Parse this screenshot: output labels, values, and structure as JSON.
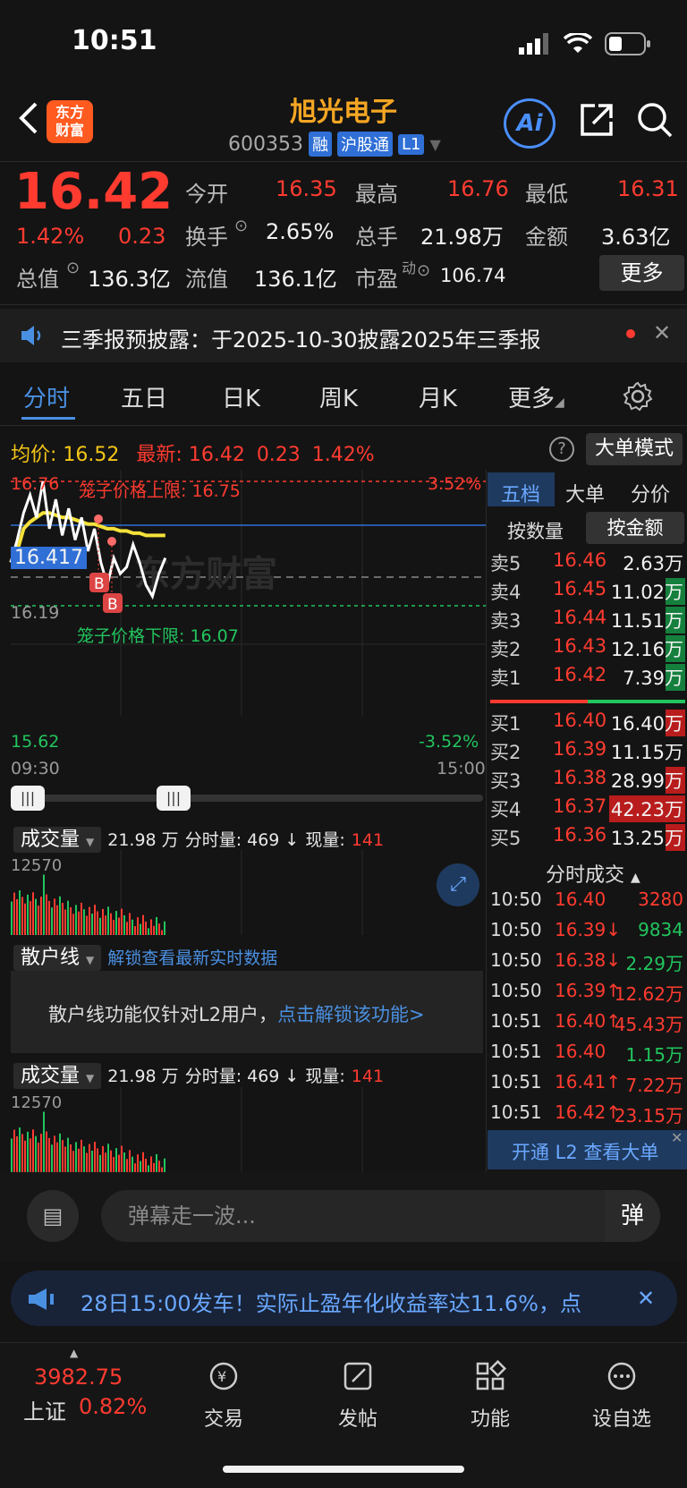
{
  "status_bar": {
    "time": "10:51"
  },
  "header": {
    "logo_line1": "东方",
    "logo_line2": "财富",
    "stock_name": "旭光电子",
    "stock_code": "600353",
    "tags": [
      "融",
      "沪股通",
      "L1"
    ],
    "ai_label": "Ai"
  },
  "quote": {
    "price": "16.42",
    "pct": "1.42%",
    "change": "0.23",
    "open_label": "今开",
    "open": "16.35",
    "high_label": "最高",
    "high": "16.76",
    "low_label": "最低",
    "low": "16.31",
    "turnover_label": "换手",
    "turnover": "2.65%",
    "volume_label": "总手",
    "volume": "21.98万",
    "amount_label": "金额",
    "amount": "3.63亿",
    "mktcap_label": "总值",
    "mktcap": "136.3亿",
    "float_label": "流值",
    "float_cap": "136.1亿",
    "pe_label": "市盈",
    "pe_sup": "动",
    "pe": "106.74",
    "more_label": "更多"
  },
  "notice": {
    "text": "三季报预披露：于2025-10-30披露2025年三季报"
  },
  "tabs": [
    "分时",
    "五日",
    "日K",
    "周K",
    "月K",
    "更多"
  ],
  "avg_row": {
    "avg_label": "均价:",
    "avg": "16.52",
    "latest_label": "最新:",
    "latest": "16.42",
    "change": "0.23",
    "pct": "1.42%",
    "bigorder_label": "大单模式"
  },
  "chart": {
    "top_price": "16.76",
    "top_pct": "3.52%",
    "upper_limit_label": "笼子价格上限: 16.75",
    "mid_price": "16.417",
    "lower_ref": "16.19",
    "lower_limit_label": "笼子价格下限: 16.07",
    "bottom_price": "15.62",
    "bottom_pct": "-3.52%",
    "time_start": "09:30",
    "time_end": "15:00",
    "watermark": "东方财富",
    "buy_marker": "B"
  },
  "chart_data": {
    "type": "line",
    "title": "",
    "xlabel": "",
    "ylabel": "",
    "ylim": [
      15.62,
      16.76
    ],
    "series": [
      {
        "name": "",
        "values": [
          16.4,
          16.5,
          16.62,
          16.7,
          16.6,
          16.76,
          16.55,
          16.68,
          16.52,
          16.64,
          16.5,
          16.6,
          16.45,
          16.55,
          16.4,
          16.3,
          16.42,
          16.35,
          16.38,
          16.48,
          16.4,
          16.3,
          16.25,
          16.35,
          16.42
        ]
      },
      {
        "name": "",
        "values": [
          16.4,
          16.45,
          16.55,
          16.58,
          16.6,
          16.62,
          16.62,
          16.61,
          16.6,
          16.6,
          16.59,
          16.58,
          16.57,
          16.57,
          16.56,
          16.55,
          16.55,
          16.54,
          16.54,
          16.53,
          16.53,
          16.52,
          16.52,
          16.52,
          16.52
        ]
      }
    ]
  },
  "order_book": {
    "tabs": [
      "五档",
      "大单",
      "分价"
    ],
    "subtabs": [
      "按数量",
      "按金额"
    ],
    "asks": [
      {
        "label": "卖5",
        "price": "16.46",
        "vol": "2.63万"
      },
      {
        "label": "卖4",
        "price": "16.45",
        "vol": "11.02万"
      },
      {
        "label": "卖3",
        "price": "16.44",
        "vol": "11.51万"
      },
      {
        "label": "卖2",
        "price": "16.43",
        "vol": "12.16万"
      },
      {
        "label": "卖1",
        "price": "16.42",
        "vol": "7.39万"
      }
    ],
    "bids": [
      {
        "label": "买1",
        "price": "16.40",
        "vol": "16.40万"
      },
      {
        "label": "买2",
        "price": "16.39",
        "vol": "11.15万"
      },
      {
        "label": "买3",
        "price": "16.38",
        "vol": "28.99万"
      },
      {
        "label": "买4",
        "price": "16.37",
        "vol": "42.23万"
      },
      {
        "label": "买5",
        "price": "16.36",
        "vol": "13.25万"
      }
    ],
    "trades_title": "分时成交",
    "trades": [
      {
        "t": "10:50",
        "p": "16.40",
        "v": "3280",
        "dir": "",
        "c": "red"
      },
      {
        "t": "10:50",
        "p": "16.39↓",
        "v": "9834",
        "c": "green"
      },
      {
        "t": "10:50",
        "p": "16.38↓",
        "v": "2.29万",
        "c": "green"
      },
      {
        "t": "10:50",
        "p": "16.39↑",
        "v": "12.62万",
        "c": "red"
      },
      {
        "t": "10:51",
        "p": "16.40↑",
        "v": "45.43万",
        "c": "red"
      },
      {
        "t": "10:51",
        "p": "16.40",
        "v": "1.15万",
        "c": "green"
      },
      {
        "t": "10:51",
        "p": "16.41↑",
        "v": "7.22万",
        "c": "red"
      },
      {
        "t": "10:51",
        "p": "16.42↑",
        "v": "23.15万",
        "c": "red"
      }
    ],
    "l2_label": "开通 L2 查看大单"
  },
  "volume_section": {
    "label": "成交量",
    "info_total": "21.98 万",
    "info_min_label": "分时量: 469 ↓",
    "info_cur_label": "现量:",
    "info_cur": "141",
    "max_value": "12570"
  },
  "retail_section": {
    "label": "散户线",
    "unlock_link": "解锁查看最新实时数据",
    "msg_prefix": "散户线功能仅针对L2用户，",
    "msg_link": "点击解锁该功能>"
  },
  "comment": {
    "placeholder": "弹幕走一波...",
    "send_label": "弹"
  },
  "ad": {
    "text": "28日15:00发车！实际止盈年化收益率达11.6%，点"
  },
  "bottom_nav": {
    "index_value": "3982.75",
    "index_name": "上证",
    "index_pct": "0.82%",
    "items": [
      "交易",
      "发帖",
      "功能",
      "设自选"
    ]
  },
  "colors": {
    "up": "#ff3b30",
    "down": "#22c55e",
    "accent": "#4a90e2",
    "brand": "#f5a623"
  }
}
